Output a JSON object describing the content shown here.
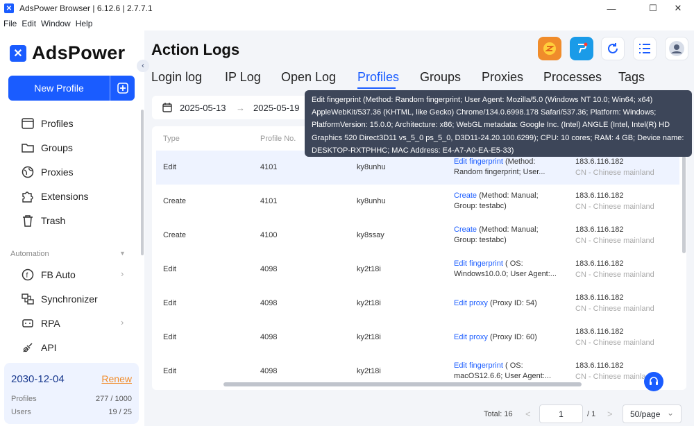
{
  "window": {
    "title": "AdsPower Browser | 6.12.6 | 2.7.7.1",
    "minimize": "—",
    "maximize": "☐",
    "close": "✕"
  },
  "menu": [
    "File",
    "Edit",
    "Window",
    "Help"
  ],
  "brand": {
    "name": "AdsPower",
    "mark": "✕"
  },
  "sidebar": {
    "new_profile": "New Profile",
    "items": [
      {
        "label": "Profiles",
        "icon": "profiles-icon"
      },
      {
        "label": "Groups",
        "icon": "folder-icon"
      },
      {
        "label": "Proxies",
        "icon": "globe-icon"
      },
      {
        "label": "Extensions",
        "icon": "puzzle-icon"
      },
      {
        "label": "Trash",
        "icon": "trash-icon"
      }
    ],
    "section_label": "Automation",
    "automation_items": [
      {
        "label": "FB Auto",
        "icon": "fb-auto-icon"
      },
      {
        "label": "Synchronizer",
        "icon": "synchronizer-icon"
      },
      {
        "label": "RPA",
        "icon": "rpa-icon"
      },
      {
        "label": "API",
        "icon": "api-icon"
      }
    ]
  },
  "plan": {
    "expiry": "2030-12-04",
    "renew": "Renew",
    "profiles_label": "Profiles",
    "profiles_value": "277 / 1000",
    "users_label": "Users",
    "users_value": "19 / 25"
  },
  "page_title": "Action Logs",
  "tabs": [
    "Login log",
    "IP Log",
    "Open Log",
    "Profiles",
    "Groups",
    "Proxies",
    "Processes",
    "Tags"
  ],
  "active_tab": "Profiles",
  "date_range": {
    "start": "2025-05-13",
    "end": "2025-05-19",
    "arrow": "→"
  },
  "table": {
    "headers": [
      "Type",
      "Profile No."
    ],
    "rows": [
      {
        "type": "Edit",
        "no": "4101",
        "user": "ky8unhu",
        "op_link": "Edit fingerprint",
        "op_line1_rest": " (Method:",
        "op_line2": "Random fingerprint; User...",
        "ip": "183.6.116.182",
        "loc": "CN - Chinese mainland"
      },
      {
        "type": "Create",
        "no": "4101",
        "user": "ky8unhu",
        "op_link": "Create",
        "op_line1_rest": " (Method: Manual;",
        "op_line2": "Group: testabc)",
        "ip": "183.6.116.182",
        "loc": "CN - Chinese mainland"
      },
      {
        "type": "Create",
        "no": "4100",
        "user": "ky8ssay",
        "op_link": "Create",
        "op_line1_rest": " (Method: Manual;",
        "op_line2": "Group: testabc)",
        "ip": "183.6.116.182",
        "loc": "CN - Chinese mainland"
      },
      {
        "type": "Edit",
        "no": "4098",
        "user": "ky2t18i",
        "op_link": "Edit fingerprint",
        "op_line1_rest": " ( OS:",
        "op_line2": "Windows10.0.0; User Agent:...",
        "ip": "183.6.116.182",
        "loc": "CN - Chinese mainland"
      },
      {
        "type": "Edit",
        "no": "4098",
        "user": "ky2t18i",
        "op_link": "Edit proxy",
        "op_line1_rest": " (Proxy ID: 54)",
        "op_line2": "",
        "ip": "183.6.116.182",
        "loc": "CN - Chinese mainland"
      },
      {
        "type": "Edit",
        "no": "4098",
        "user": "ky2t18i",
        "op_link": "Edit proxy",
        "op_line1_rest": " (Proxy ID: 60)",
        "op_line2": "",
        "ip": "183.6.116.182",
        "loc": "CN - Chinese mainland"
      },
      {
        "type": "Edit",
        "no": "4098",
        "user": "ky2t18i",
        "op_link": "Edit fingerprint",
        "op_line1_rest": " ( OS:",
        "op_line2": "macOS12.6.6; User Agent:...",
        "ip": "183.6.116.182",
        "loc": "CN - Chinese mainla"
      }
    ]
  },
  "tooltip": "Edit fingerprint (Method: Random fingerprint; User Agent: Mozilla/5.0 (Windows NT 10.0; Win64; x64)\nAppleWebKit/537.36 (KHTML, like Gecko) Chrome/134.0.6998.178 Safari/537.36; Platform: Windows;\nPlatformVersion: 15.0.0; Architecture: x86; WebGL metadata: Google Inc. (Intel) ANGLE (Intel, Intel(R) HD\nGraphics 520 Direct3D11 vs_5_0 ps_5_0, D3D11-24.20.100.6299); CPU: 10 cores; RAM: 4 GB; Device name:\nDESKTOP-RXTPHHC; MAC Address: E4-A7-A0-EA-E5-33)",
  "pagination": {
    "total": "Total: 16",
    "prev": "<",
    "current": "1",
    "of": "/ 1",
    "next": ">",
    "page_size": "50/page",
    "page_size_chevron": "⌄"
  },
  "colors": {
    "accent": "#1a5cff",
    "renew": "#f08c2b",
    "tooltip_bg": "#3d4659"
  }
}
